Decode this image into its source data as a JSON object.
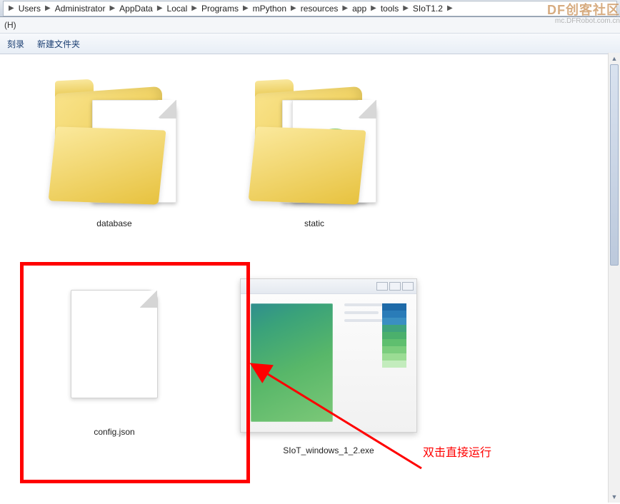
{
  "breadcrumb": [
    "Users",
    "Administrator",
    "AppData",
    "Local",
    "Programs",
    "mPython",
    "resources",
    "app",
    "tools",
    "SIoT1.2"
  ],
  "menubar": {
    "help": "(H)"
  },
  "toolbar": {
    "burn": "刻录",
    "new_folder": "新建文件夹"
  },
  "items": [
    {
      "name": "database",
      "type": "folder"
    },
    {
      "name": "static",
      "type": "folder-overlay"
    },
    {
      "name": "config.json",
      "type": "file"
    },
    {
      "name": "SIoT_windows_1_2.exe",
      "type": "exe"
    }
  ],
  "annotation": {
    "text": "双击直接运行"
  },
  "watermark": {
    "main": "DF创客社区",
    "sub": "mc.DFRobot.com.cn"
  }
}
